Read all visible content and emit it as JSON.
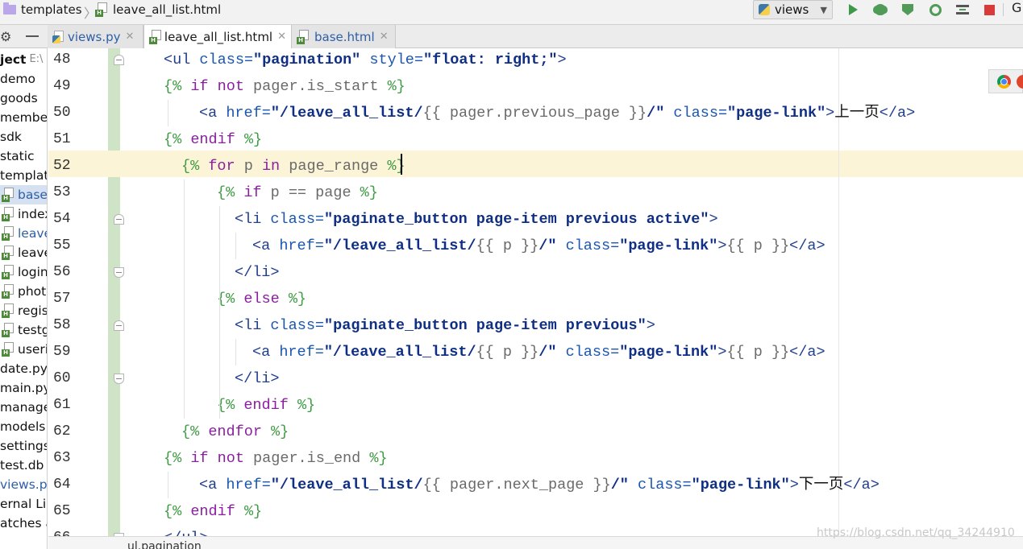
{
  "breadcrumb": {
    "folder": "templates",
    "file": "leave_all_list.html"
  },
  "toolbar": {
    "run_config": "views",
    "search_glyph": "G",
    "icons": [
      "run-icon",
      "debug-icon",
      "coverage-icon",
      "profile-icon",
      "concurrency-icon",
      "stop-icon"
    ]
  },
  "tabs": [
    {
      "label": "views.py",
      "active": false
    },
    {
      "label": "leave_all_list.html",
      "active": true
    },
    {
      "label": "base.html",
      "active": false
    }
  ],
  "sidebar": {
    "header_bold": "ject",
    "header_path": "E:\\",
    "items": [
      {
        "label": "demo",
        "icon": "none",
        "blue": false,
        "selected": false
      },
      {
        "label": "goods",
        "icon": "none",
        "blue": false,
        "selected": false
      },
      {
        "label": "member",
        "icon": "none",
        "blue": false,
        "selected": false
      },
      {
        "label": "sdk",
        "icon": "none",
        "blue": false,
        "selected": false
      },
      {
        "label": "static",
        "icon": "none",
        "blue": false,
        "selected": false
      },
      {
        "label": "template",
        "icon": "none",
        "blue": false,
        "selected": false
      },
      {
        "label": "base",
        "icon": "html-file-icon",
        "blue": true,
        "selected": true
      },
      {
        "label": "index",
        "icon": "html-file-icon",
        "blue": false,
        "selected": false
      },
      {
        "label": "leave",
        "icon": "html-file-icon",
        "blue": true,
        "selected": false
      },
      {
        "label": "leave",
        "icon": "html-file-icon",
        "blue": false,
        "selected": false
      },
      {
        "label": "login",
        "icon": "html-file-icon",
        "blue": false,
        "selected": false
      },
      {
        "label": "phot",
        "icon": "html-file-icon",
        "blue": false,
        "selected": false
      },
      {
        "label": "regis",
        "icon": "html-file-icon",
        "blue": false,
        "selected": false
      },
      {
        "label": "testg",
        "icon": "html-file-icon",
        "blue": false,
        "selected": false
      },
      {
        "label": "useri",
        "icon": "html-file-icon",
        "blue": false,
        "selected": false
      },
      {
        "label": "date.py",
        "icon": "none",
        "blue": false,
        "selected": false
      },
      {
        "label": "main.py",
        "icon": "none",
        "blue": false,
        "selected": false
      },
      {
        "label": "manage",
        "icon": "none",
        "blue": false,
        "selected": false
      },
      {
        "label": "models.",
        "icon": "none",
        "blue": false,
        "selected": false
      },
      {
        "label": "settings",
        "icon": "none",
        "blue": false,
        "selected": false
      },
      {
        "label": "test.db",
        "icon": "none",
        "blue": false,
        "selected": false
      },
      {
        "label": "views.py",
        "icon": "none",
        "blue": true,
        "selected": false
      },
      {
        "label": "ernal Lib",
        "icon": "none",
        "blue": false,
        "selected": false
      },
      {
        "label": "atches ar",
        "icon": "none",
        "blue": false,
        "selected": false
      }
    ]
  },
  "editor": {
    "current_line": 52,
    "lines": [
      {
        "num": "48",
        "indent": 0,
        "fold": "start",
        "tokens": [
          [
            "t-tag",
            "<ul "
          ],
          [
            "t-attr",
            "class="
          ],
          [
            "t-str",
            "\"pagination\""
          ],
          [
            "t-attr",
            " style="
          ],
          [
            "t-str",
            "\"float: right;\""
          ],
          [
            "t-tag",
            ">"
          ]
        ]
      },
      {
        "num": "49",
        "indent": 0,
        "fold": "",
        "tokens": [
          [
            "t-tpl",
            "{% "
          ],
          [
            "t-kw",
            "if not "
          ],
          [
            "t-var",
            "pager.is_start "
          ],
          [
            "t-tpl",
            "%}"
          ]
        ]
      },
      {
        "num": "50",
        "indent": 1,
        "fold": "",
        "tokens": [
          [
            "t-tag",
            "<a "
          ],
          [
            "t-attr",
            "href="
          ],
          [
            "t-str",
            "\"/leave_all_list/"
          ],
          [
            "t-var",
            "{{ pager.previous_page }}"
          ],
          [
            "t-str",
            "/\""
          ],
          [
            "t-attr",
            " class="
          ],
          [
            "t-str",
            "\"page-link\""
          ],
          [
            "t-tag",
            ">"
          ],
          [
            "t-txt",
            "上一页"
          ],
          [
            "t-tag",
            "</a>"
          ]
        ]
      },
      {
        "num": "51",
        "indent": 0,
        "fold": "",
        "tokens": [
          [
            "t-tpl",
            "{% "
          ],
          [
            "t-kw",
            "endif "
          ],
          [
            "t-tpl",
            "%}"
          ]
        ]
      },
      {
        "num": "52",
        "indent": 0.5,
        "fold": "",
        "tokens": [
          [
            "t-tpl",
            "{% "
          ],
          [
            "t-kw",
            "for "
          ],
          [
            "t-var",
            "p "
          ],
          [
            "t-kw",
            "in "
          ],
          [
            "t-var",
            "page_range "
          ],
          [
            "t-tpl",
            "%}"
          ]
        ]
      },
      {
        "num": "53",
        "indent": 1.5,
        "fold": "",
        "tokens": [
          [
            "t-tpl",
            "{% "
          ],
          [
            "t-kw",
            "if "
          ],
          [
            "t-var",
            "p == page "
          ],
          [
            "t-tpl",
            "%}"
          ]
        ]
      },
      {
        "num": "54",
        "indent": 2,
        "fold": "start",
        "tokens": [
          [
            "t-tag",
            "<li "
          ],
          [
            "t-attr",
            "class="
          ],
          [
            "t-str",
            "\"paginate_button page-item previous active\""
          ],
          [
            "t-tag",
            ">"
          ]
        ]
      },
      {
        "num": "55",
        "indent": 2.5,
        "fold": "",
        "tokens": [
          [
            "t-tag",
            "<a "
          ],
          [
            "t-attr",
            "href="
          ],
          [
            "t-str",
            "\"/leave_all_list/"
          ],
          [
            "t-var",
            "{{ p }}"
          ],
          [
            "t-str",
            "/\""
          ],
          [
            "t-attr",
            " class="
          ],
          [
            "t-str",
            "\"page-link\""
          ],
          [
            "t-tag",
            ">"
          ],
          [
            "t-var",
            "{{ p }}"
          ],
          [
            "t-tag",
            "</a>"
          ]
        ]
      },
      {
        "num": "56",
        "indent": 2,
        "fold": "end",
        "tokens": [
          [
            "t-tag",
            "</li>"
          ]
        ]
      },
      {
        "num": "57",
        "indent": 1.5,
        "fold": "",
        "tokens": [
          [
            "t-tpl",
            "{% "
          ],
          [
            "t-kw",
            "else "
          ],
          [
            "t-tpl",
            "%}"
          ]
        ]
      },
      {
        "num": "58",
        "indent": 2,
        "fold": "start",
        "tokens": [
          [
            "t-tag",
            "<li "
          ],
          [
            "t-attr",
            "class="
          ],
          [
            "t-str",
            "\"paginate_button page-item previous\""
          ],
          [
            "t-tag",
            ">"
          ]
        ]
      },
      {
        "num": "59",
        "indent": 2.5,
        "fold": "",
        "tokens": [
          [
            "t-tag",
            "<a "
          ],
          [
            "t-attr",
            "href="
          ],
          [
            "t-str",
            "\"/leave_all_list/"
          ],
          [
            "t-var",
            "{{ p }}"
          ],
          [
            "t-str",
            "/\""
          ],
          [
            "t-attr",
            " class="
          ],
          [
            "t-str",
            "\"page-link\""
          ],
          [
            "t-tag",
            ">"
          ],
          [
            "t-var",
            "{{ p }}"
          ],
          [
            "t-tag",
            "</a>"
          ]
        ]
      },
      {
        "num": "60",
        "indent": 2,
        "fold": "end",
        "tokens": [
          [
            "t-tag",
            "</li>"
          ]
        ]
      },
      {
        "num": "61",
        "indent": 1.5,
        "fold": "",
        "tokens": [
          [
            "t-tpl",
            "{% "
          ],
          [
            "t-kw",
            "endif "
          ],
          [
            "t-tpl",
            "%}"
          ]
        ]
      },
      {
        "num": "62",
        "indent": 0.5,
        "fold": "",
        "tokens": [
          [
            "t-tpl",
            "{% "
          ],
          [
            "t-kw",
            "endfor "
          ],
          [
            "t-tpl",
            "%}"
          ]
        ]
      },
      {
        "num": "63",
        "indent": 0,
        "fold": "",
        "tokens": [
          [
            "t-tpl",
            "{% "
          ],
          [
            "t-kw",
            "if not "
          ],
          [
            "t-var",
            "pager.is_end "
          ],
          [
            "t-tpl",
            "%}"
          ]
        ]
      },
      {
        "num": "64",
        "indent": 1,
        "fold": "",
        "tokens": [
          [
            "t-tag",
            "<a "
          ],
          [
            "t-attr",
            "href="
          ],
          [
            "t-str",
            "\"/leave_all_list/"
          ],
          [
            "t-var",
            "{{ pager.next_page }}"
          ],
          [
            "t-str",
            "/\""
          ],
          [
            "t-attr",
            " class="
          ],
          [
            "t-str",
            "\"page-link\""
          ],
          [
            "t-tag",
            ">"
          ],
          [
            "t-txt",
            "下一页"
          ],
          [
            "t-tag",
            "</a>"
          ]
        ]
      },
      {
        "num": "65",
        "indent": 0,
        "fold": "",
        "tokens": [
          [
            "t-tpl",
            "{% "
          ],
          [
            "t-kw",
            "endif "
          ],
          [
            "t-tpl",
            "%}"
          ]
        ]
      },
      {
        "num": "66",
        "indent": 0,
        "fold": "end",
        "tokens": [
          [
            "t-tag",
            "</ul>"
          ]
        ]
      }
    ]
  },
  "status": {
    "crumb": "ul.pagination"
  },
  "watermark": "https://blog.csdn.net/qq_34244910",
  "colors": {
    "current_line": "#fbf4d6",
    "change_bar": "#cfe3c7",
    "selection": "#d5e1f0"
  }
}
